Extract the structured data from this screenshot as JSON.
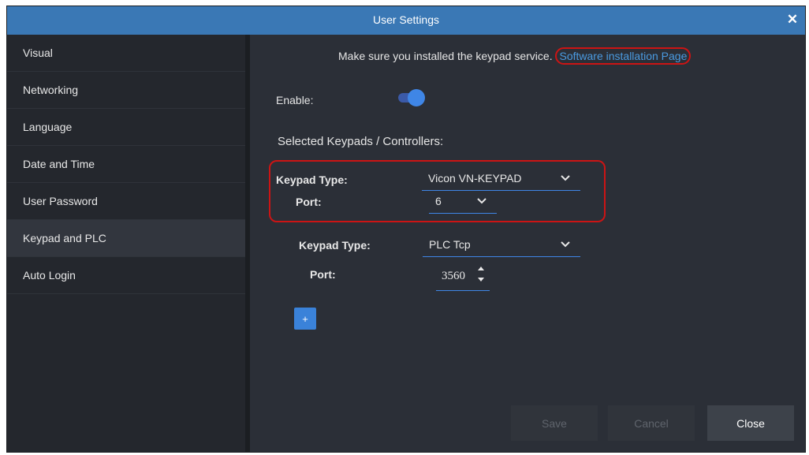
{
  "window": {
    "title": "User Settings",
    "close_symbol": "✕"
  },
  "sidebar": {
    "items": [
      {
        "label": "Visual"
      },
      {
        "label": "Networking"
      },
      {
        "label": "Language"
      },
      {
        "label": "Date and Time"
      },
      {
        "label": "User Password"
      },
      {
        "label": "Keypad and PLC",
        "active": true
      },
      {
        "label": "Auto Login"
      }
    ]
  },
  "main": {
    "notice_text": "Make sure you installed the keypad service.",
    "notice_link": "Software installation Page",
    "enable_label": "Enable:",
    "enable_on": true,
    "section_title": "Selected Keypads / Controllers:",
    "keypads": [
      {
        "type_label": "Keypad Type:",
        "type_value": "Vicon VN-KEYPAD",
        "port_label": "Port:",
        "port_value": "6",
        "port_control": "dropdown"
      },
      {
        "type_label": "Keypad Type:",
        "type_value": "PLC Tcp",
        "port_label": "Port:",
        "port_value": "3560",
        "port_control": "spinner"
      }
    ],
    "add_label": "+"
  },
  "footer": {
    "save_label": "Save",
    "cancel_label": "Cancel",
    "close_label": "Close"
  },
  "colors": {
    "titlebar": "#3a78b5",
    "background": "#2b2f37",
    "sidebar": "#24272d",
    "accent": "#3f86e6",
    "highlight": "#cc1414",
    "link": "#4a9ae0"
  },
  "icons": [
    "close-icon",
    "chevron-down-icon",
    "spinner-up-icon",
    "spinner-down-icon",
    "plus-icon"
  ]
}
